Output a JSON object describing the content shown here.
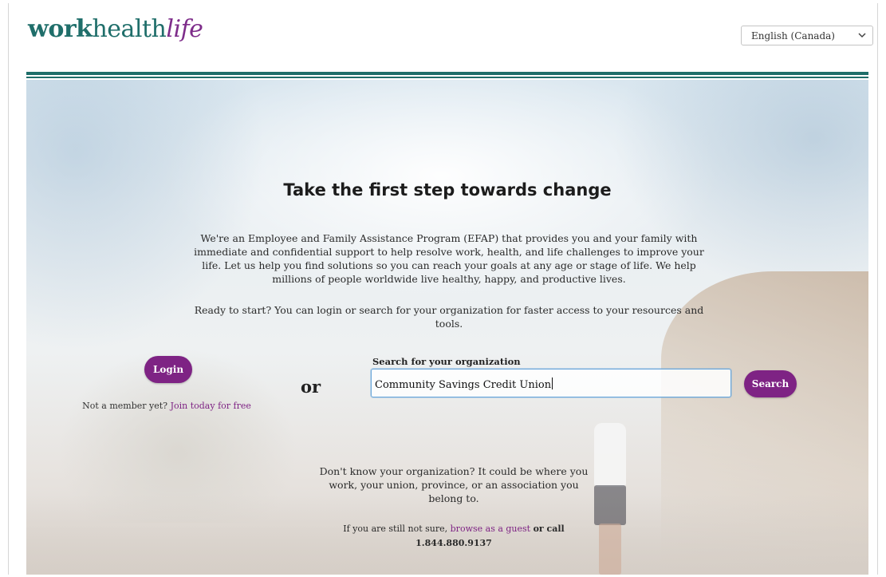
{
  "header": {
    "logo": {
      "part1": "work",
      "part2": "health",
      "part3": "life"
    },
    "language_select": {
      "value": "English (Canada)",
      "icon": "chevron-down-icon"
    }
  },
  "hero": {
    "title": "Take the first step towards change",
    "intro": "We're an Employee and Family Assistance Program (EFAP) that provides you and your family with immediate and confidential support to help resolve work, health, and life challenges to improve your life. Let us help you find solutions so you can reach your goals at any age or stage of life. We help millions of people worldwide live healthy, happy, and productive lives.",
    "ready": "Ready to start? You can login or search for your organization for faster access to your resources and tools."
  },
  "login": {
    "button_label": "Login",
    "not_member_text": "Not a member yet?",
    "join_link": "Join today for free"
  },
  "separator": "or",
  "search": {
    "label": "Search for your organization",
    "input_value": "Community Savings Credit Union",
    "button_label": "Search"
  },
  "help": {
    "dont_know": "Don't know your organization? It could be where you work, your union, province, or an association you belong to.",
    "still_not_sure": "If you are still not sure,",
    "guest_link": "browse as a guest",
    "or_call": "or call",
    "phone": "1.844.880.9137"
  },
  "colors": {
    "brand_teal": "#1f6e6a",
    "brand_purple": "#7e2384"
  }
}
